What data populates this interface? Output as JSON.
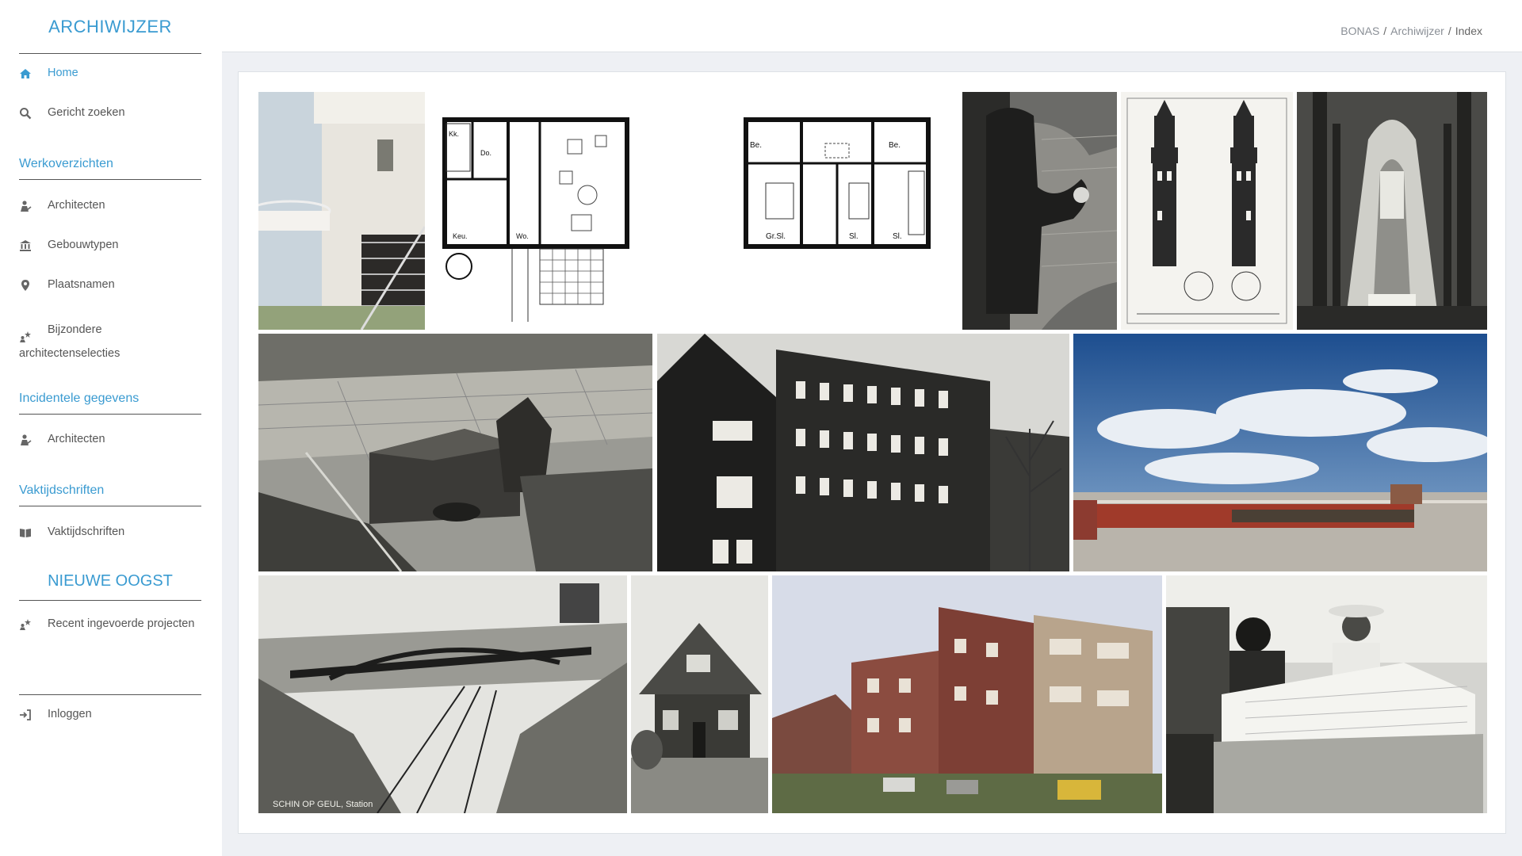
{
  "sidebar": {
    "brand": "ARCHIWIJZER",
    "home": "Home",
    "search": "Gericht zoeken",
    "werkoverzichten": {
      "title": "Werkoverzichten",
      "items": [
        "Architecten",
        "Gebouwtypen",
        "Plaatsnamen",
        "Bijzondere architectenselecties"
      ]
    },
    "incidentele": {
      "title": "Incidentele gegevens",
      "items": [
        "Architecten"
      ]
    },
    "vaktijdschriften": {
      "title": "Vaktijdschriften",
      "items": [
        "Vaktijdschriften"
      ]
    },
    "nieuwe_oogst": {
      "title": "NIEUWE OOGST",
      "items": [
        "Recent ingevoerde projecten"
      ]
    },
    "login": "Inloggen"
  },
  "breadcrumb": [
    "BONAS",
    "Archiwijzer",
    "Index"
  ],
  "gallery": {
    "captions": {
      "railway_station": "SCHIN OP GEUL, Station"
    },
    "floorplan_1_labels": [
      "Kk.",
      "Do.",
      "Keu.",
      "Wo."
    ],
    "floorplan_2_labels": [
      "Be.",
      "Be.",
      "Gr.Sl.",
      "Sl.",
      "Sl."
    ]
  },
  "colors": {
    "accent": "#3a9bd1",
    "text": "#555555",
    "background": "#eef0f4"
  }
}
